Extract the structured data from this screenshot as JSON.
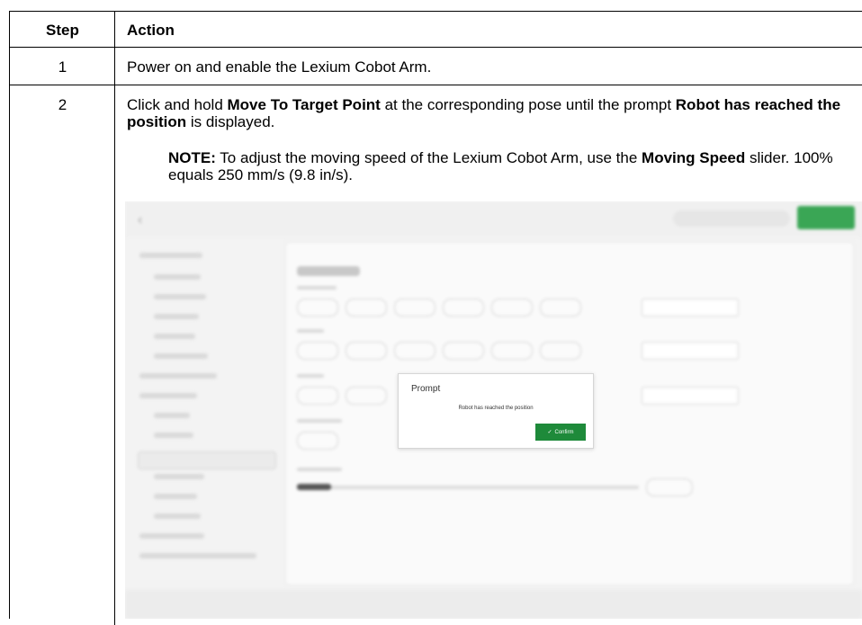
{
  "table": {
    "headers": {
      "step": "Step",
      "action": "Action"
    },
    "row1": {
      "step": "1",
      "action": "Power on and enable the Lexium Cobot Arm."
    },
    "row2": {
      "step": "2",
      "action_pre": "Click and hold ",
      "action_bold1": "Move To Target Point",
      "action_mid": " at the corresponding pose until the prompt ",
      "action_bold2": "Robot has reached the position",
      "action_post": " is displayed.",
      "note_label": "NOTE:",
      "note_pre": " To adjust the moving speed of the Lexium Cobot Arm, use the ",
      "note_bold": "Moving Speed",
      "note_post": " slider. 100% equals 250 mm/s (9.8 in/s)."
    }
  },
  "screenshot": {
    "back_glyph": "‹",
    "dialog": {
      "title": "Prompt",
      "message": "Robot has reached the position",
      "check_glyph": "✓",
      "confirm_label": "Confirm"
    }
  }
}
